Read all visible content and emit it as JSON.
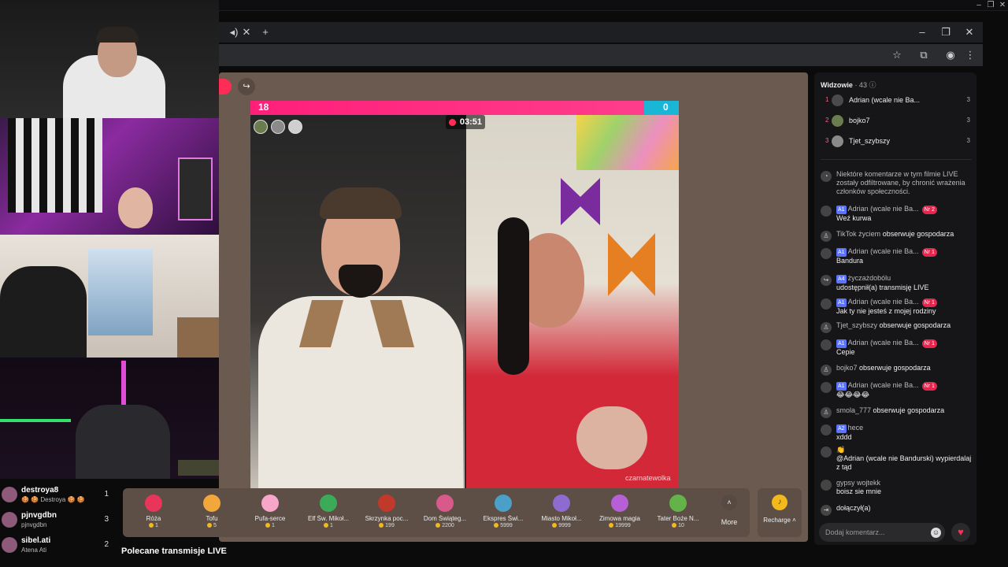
{
  "window": {
    "controls": [
      "–",
      "❐",
      "✕"
    ]
  },
  "browser": {
    "tab_icons": [
      "speaker-icon",
      "close-icon",
      "plus-icon"
    ],
    "tab_close": "✕",
    "new_tab": "+",
    "window_min": "–",
    "window_max": "❐",
    "window_close": "✕",
    "toolbar": {
      "star": "☆",
      "extensions": "⧉",
      "profile": "◉",
      "menu": "⋮"
    }
  },
  "live": {
    "score_left": "18",
    "score_right": "0",
    "timer": "03:51",
    "overlay_name": "czarnatewolka",
    "share_btn": "↪"
  },
  "gifts": [
    {
      "name": "Róża",
      "price": "1",
      "color": "#e8355a"
    },
    {
      "name": "Tofu",
      "price": "5",
      "color": "#f2a73b"
    },
    {
      "name": "Pufa-serce",
      "price": "1",
      "color": "#f7a5c8"
    },
    {
      "name": "Elf Św. Mikoł...",
      "price": "1",
      "color": "#3bab57"
    },
    {
      "name": "Skrzynka poc...",
      "price": "199",
      "color": "#c0392b"
    },
    {
      "name": "Dom Świąteg...",
      "price": "2200",
      "color": "#d75a8a"
    },
    {
      "name": "Ekspres Świ...",
      "price": "5999",
      "color": "#4aa0c9"
    },
    {
      "name": "Miasto Mikoł...",
      "price": "9999",
      "color": "#8e6bd0"
    },
    {
      "name": "Zimowa magia",
      "price": "19999",
      "color": "#b65fd6"
    },
    {
      "name": "Tater Boże N...",
      "price": "10",
      "color": "#63b34a"
    }
  ],
  "more_label": "More",
  "recharge_label": "Recharge ˄",
  "viewers": {
    "title": "Widzowie",
    "count": "· 43",
    "list": [
      {
        "rank": "1",
        "name": "Adrian (wcale nie Ba...",
        "count": "3"
      },
      {
        "rank": "2",
        "name": "bojko7",
        "count": "3"
      },
      {
        "rank": "3",
        "name": "Tjet_szybszy",
        "count": "3"
      }
    ]
  },
  "chat": [
    {
      "type": "system",
      "text": "Niektóre komentarze w tym filmie LIVE zostały odfiltrowane, by chronić wrażenia członków społeczności."
    },
    {
      "type": "msg",
      "lvl": "A1",
      "user": "Adrian (wcale nie Ba...",
      "badge": "Nr 2",
      "text": "Weź kurwa"
    },
    {
      "type": "event",
      "user": "TikTok życiem",
      "text": "obserwuje gospodarza"
    },
    {
      "type": "msg",
      "lvl": "A1",
      "user": "Adrian (wcale nie Ba...",
      "badge": "Nr 1",
      "text": "Bandura"
    },
    {
      "type": "share",
      "lvl": "A4",
      "user": "życzażdobólu",
      "text": "udostępnił(a) transmisję LIVE"
    },
    {
      "type": "msg",
      "lvl": "A1",
      "user": "Adrian (wcale nie Ba...",
      "badge": "Nr 1",
      "text": "Jak ty nie jesteś z mojej rodziny"
    },
    {
      "type": "event",
      "user": "Tjet_szybszy",
      "text": "obserwuje gospodarza"
    },
    {
      "type": "msg",
      "lvl": "A1",
      "user": "Adrian (wcale nie Ba...",
      "badge": "Nr 1",
      "text": "Cepie"
    },
    {
      "type": "event",
      "user": "bojko7",
      "text": "obserwuje gospodarza"
    },
    {
      "type": "msg",
      "lvl": "A1",
      "user": "Adrian (wcale nie Ba...",
      "badge": "Nr 1",
      "text": "😂😂😂😂"
    },
    {
      "type": "event",
      "user": "smola_777",
      "text": "obserwuje gospodarza"
    },
    {
      "type": "msg",
      "lvl": "A2",
      "user": "hece",
      "badge": "",
      "text": "xddd"
    },
    {
      "type": "msg",
      "lvl": "",
      "user": "👏",
      "badge": "",
      "text": "@Adrian (wcale nie Bandurski) wypierdalaj z tąd"
    },
    {
      "type": "msg",
      "lvl": "",
      "user": "gypsy wojtekk",
      "badge": "",
      "text": "boisz sie mnie"
    },
    {
      "type": "join",
      "user": "",
      "text": "dołączył(a)"
    }
  ],
  "comment_placeholder": "Dodaj komentarz...",
  "recommended": "Polecane transmisje LIVE",
  "stream_viewers": [
    {
      "name": "destroya8",
      "sub": "🍪 🍪 Destroya 🍪 🍪",
      "rank": "1"
    },
    {
      "name": "pjnvgdbn",
      "sub": "pjnvgdbn",
      "rank": "3"
    },
    {
      "name": "sibel.ati",
      "sub": "Atena Ati",
      "rank": "2"
    }
  ]
}
